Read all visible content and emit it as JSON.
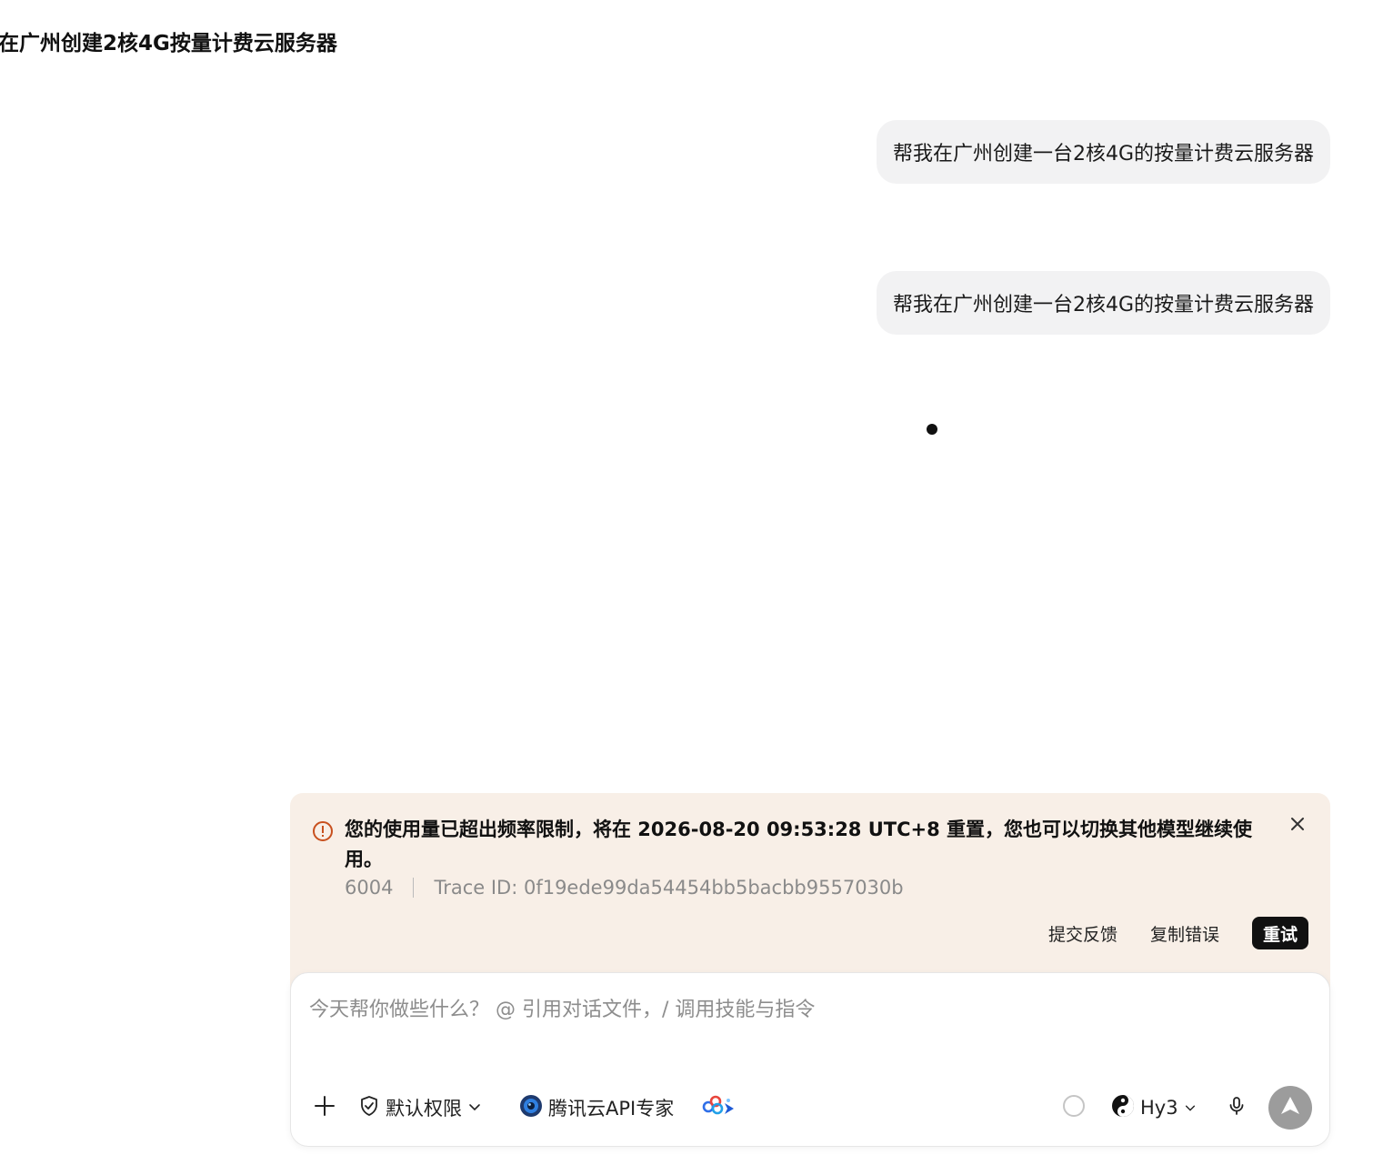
{
  "chat": {
    "title": "在广州创建2核4G按量计费云服务器",
    "messages": [
      {
        "role": "user",
        "text": "帮我在广州创建一台2核4G的按量计费云服务器"
      },
      {
        "role": "user",
        "text": "帮我在广州创建一台2核4G的按量计费云服务器"
      }
    ]
  },
  "error": {
    "message": "您的使用量已超出频率限制，将在 2026-08-20 09:53:28 UTC+8 重置，您也可以切换其他模型继续使用。",
    "code": "6004",
    "trace": "Trace ID: 0f19ede99da54454bb5bacbb9557030b",
    "actions": {
      "feedback": "提交反馈",
      "copy": "复制错误",
      "retry": "重试"
    },
    "icon": "alert-circle-icon",
    "accent_color": "#c8501e"
  },
  "composer": {
    "placeholder": "今天帮你做些什么？ @ 引用对话文件，/ 调用技能与指令",
    "value": "",
    "permission_label": "默认权限",
    "expert_label": "腾讯云API专家",
    "model_label": "Hy3"
  },
  "colors": {
    "bubble_bg": "#f2f2f3",
    "error_bg": "#f8efe7",
    "send_bg": "#9c9c9c"
  }
}
